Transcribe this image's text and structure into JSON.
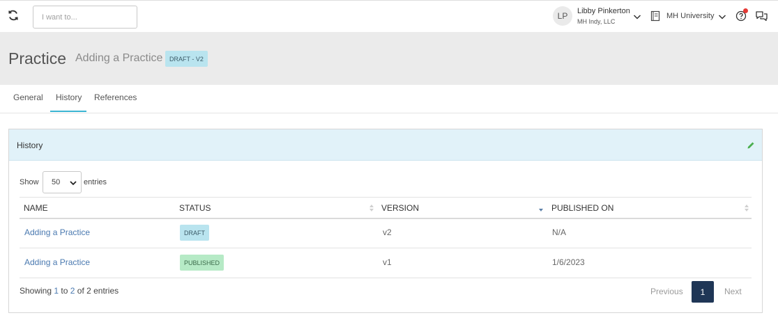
{
  "topbar": {
    "search_placeholder": "I want to...",
    "avatar_initials": "LP",
    "user_name": "Libby Pinkerton",
    "user_org": "MH Indy, LLC",
    "university_label": "MH University",
    "icons": [
      "refresh-icon",
      "chevron-down-icon",
      "book-icon",
      "help-icon",
      "chat-icon"
    ],
    "notification_color": "#e53935"
  },
  "header": {
    "title": "Practice",
    "subtitle": "Adding a Practice",
    "badge": "DRAFT - V2"
  },
  "tabs": [
    {
      "label": "General",
      "active": false
    },
    {
      "label": "History",
      "active": true
    },
    {
      "label": "References",
      "active": false
    }
  ],
  "panel": {
    "title": "History",
    "show_label": "Show",
    "entries_value": "50",
    "entries_label": "entries",
    "columns": [
      "NAME",
      "STATUS",
      "VERSION",
      "PUBLISHED ON"
    ],
    "rows": [
      {
        "name": "Adding a Practice",
        "status": "DRAFT",
        "version": "v2",
        "published_on": "N/A"
      },
      {
        "name": "Adding a Practice",
        "status": "PUBLISHED",
        "version": "v1",
        "published_on": "1/6/2023"
      }
    ],
    "footer": {
      "showing_prefix": "Showing ",
      "from": "1",
      "to_word": " to ",
      "to": "2",
      "of_text": " of 2 entries"
    },
    "pagination": {
      "previous": "Previous",
      "current": "1",
      "next": "Next"
    }
  },
  "colors": {
    "accent": "#3ab4d2",
    "link": "#4a79b0",
    "draft_badge": "#b9e4ef",
    "published_badge": "#b6eac6",
    "page_active": "#1f3656",
    "panel_header": "#e1f2f9"
  }
}
